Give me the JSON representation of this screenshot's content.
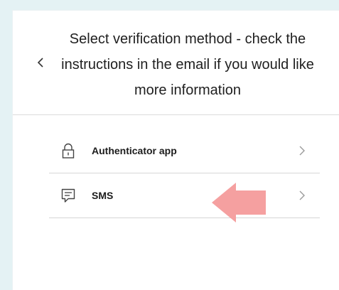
{
  "header": {
    "title": "Select verification method - check the instructions in the email if you would like more information"
  },
  "icons": {
    "back": "chevron-left-icon",
    "chevron": "chevron-right-icon",
    "lock": "lock-icon",
    "message": "message-icon",
    "pointer": "arrow-left-icon"
  },
  "methods": [
    {
      "label": "Authenticator app",
      "icon": "lock-icon"
    },
    {
      "label": "SMS",
      "icon": "message-icon"
    }
  ],
  "colors": {
    "background": "#e4f2f4",
    "panel": "#ffffff",
    "divider": "#d6d6d6",
    "text": "#1f1f1f",
    "icon": "#444444",
    "chevron": "#9a9a9a",
    "annotation_arrow": "#f5a0a0"
  }
}
